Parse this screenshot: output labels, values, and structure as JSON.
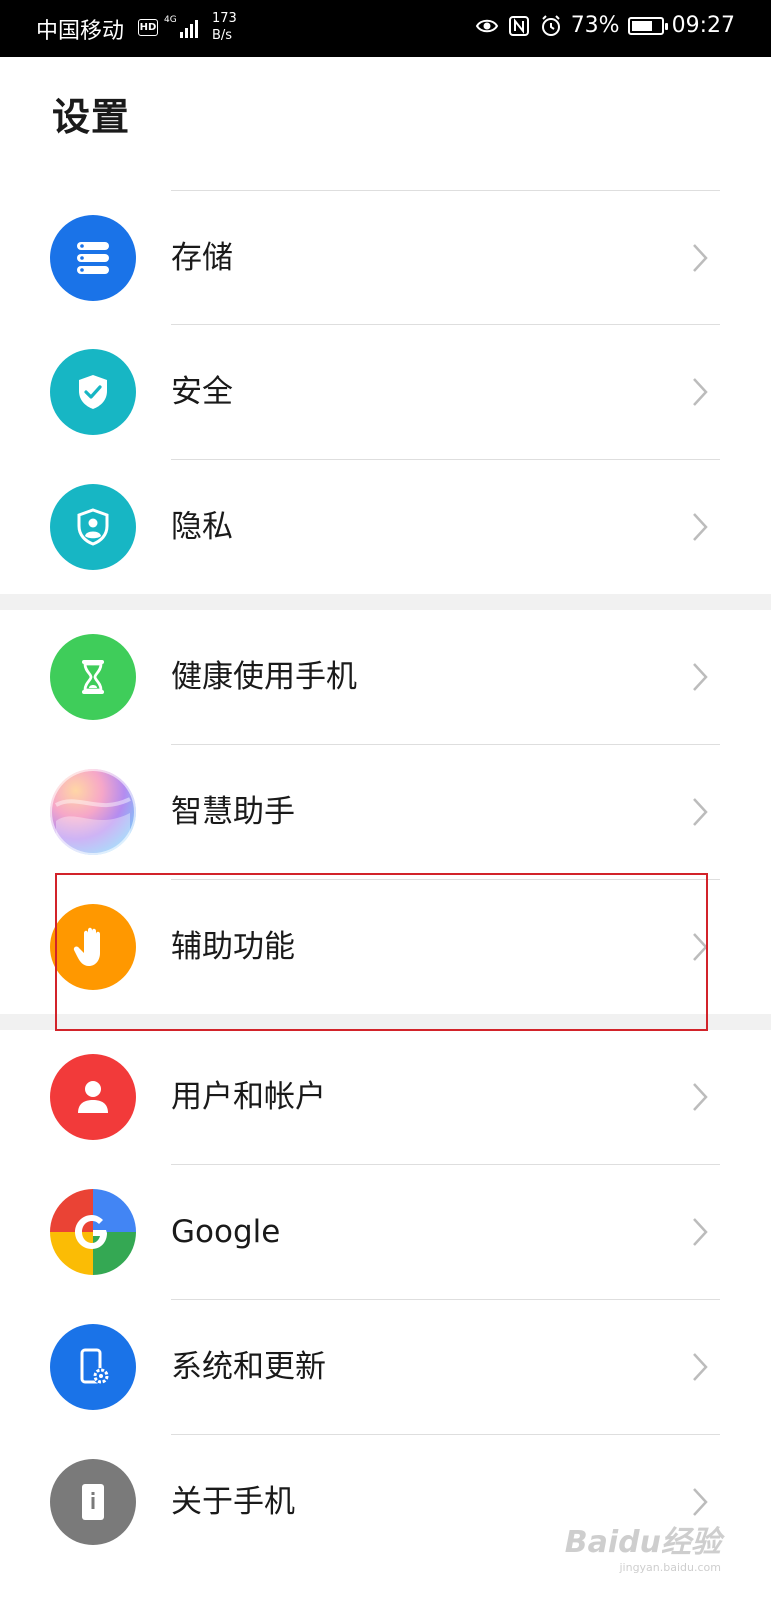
{
  "status_bar": {
    "carrier": "中国移动",
    "hd": "HD",
    "network": "4G",
    "speed_value": "173",
    "speed_unit": "B/s",
    "battery_text": "73%",
    "battery_level": 0.73,
    "time": "09:27"
  },
  "page": {
    "title": "设置"
  },
  "items": [
    {
      "label": "存储",
      "icon": "storage-icon",
      "color": "#1a73e8"
    },
    {
      "label": "安全",
      "icon": "shield-check-icon",
      "color": "#17b6c4"
    },
    {
      "label": "隐私",
      "icon": "privacy-shield-person-icon",
      "color": "#17b6c4"
    },
    {
      "label": "健康使用手机",
      "icon": "hourglass-icon",
      "color": "#3fcd5a"
    },
    {
      "label": "智慧助手",
      "icon": "smart-assistant-icon",
      "color": "#b48cf0"
    },
    {
      "label": "辅助功能",
      "icon": "hand-icon",
      "color": "#ff9800"
    },
    {
      "label": "用户和帐户",
      "icon": "user-icon",
      "color": "#f23a3a"
    },
    {
      "label": "Google",
      "icon": "google-icon",
      "color": "#4285f4"
    },
    {
      "label": "系统和更新",
      "icon": "phone-settings-icon",
      "color": "#1a73e8"
    },
    {
      "label": "关于手机",
      "icon": "phone-info-icon",
      "color": "#7a7a7a"
    }
  ],
  "watermark": {
    "text": "Baidu经验",
    "sub": "jingyan.baidu.com"
  }
}
